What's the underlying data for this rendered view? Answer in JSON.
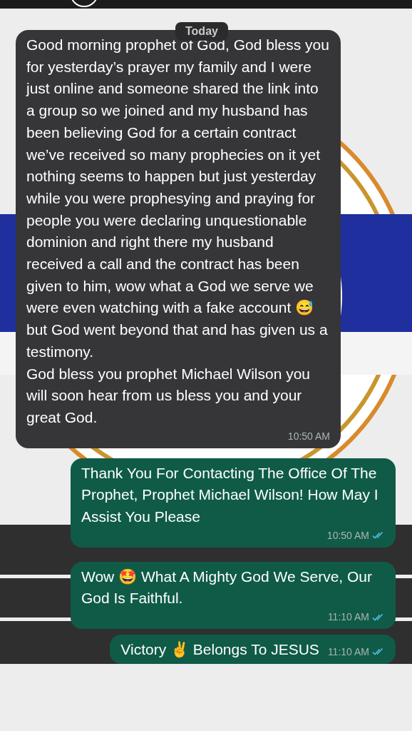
{
  "date_chip": "Today",
  "messages": [
    {
      "kind": "incoming",
      "text": "Good morning prophet of God, God bless you for yesterday’s prayer my family and I were just online and someone shared the link into a group so we joined and my husband has been believing God for a certain contract we’ve received so many prophecies on it yet nothing seems to happen but just yesterday while you were prophesying and praying for people you were declaring unquestionable dominion and right there my husband received a call and the contract has been given to him, wow what a God we serve we were even watching with a fake account 😅 but God went beyond that and has given us a testimony.\nGod bless you prophet Michael Wilson you will soon hear from us bless you and your great God.",
      "time": "10:50 AM"
    },
    {
      "kind": "outgoing",
      "text": "Thank You For Contacting The Office Of The Prophet, Prophet Michael Wilson! How May I Assist You Please",
      "time": "10:50 AM",
      "read": true
    },
    {
      "kind": "outgoing",
      "text": "Wow 🤩 What A Mighty God We Serve, Our God Is Faithful.",
      "time": "11:10 AM",
      "read": true
    },
    {
      "kind": "outgoing",
      "text": "Victory ✌️ Belongs To JESUS",
      "time": "11:10 AM",
      "read": true
    }
  ]
}
